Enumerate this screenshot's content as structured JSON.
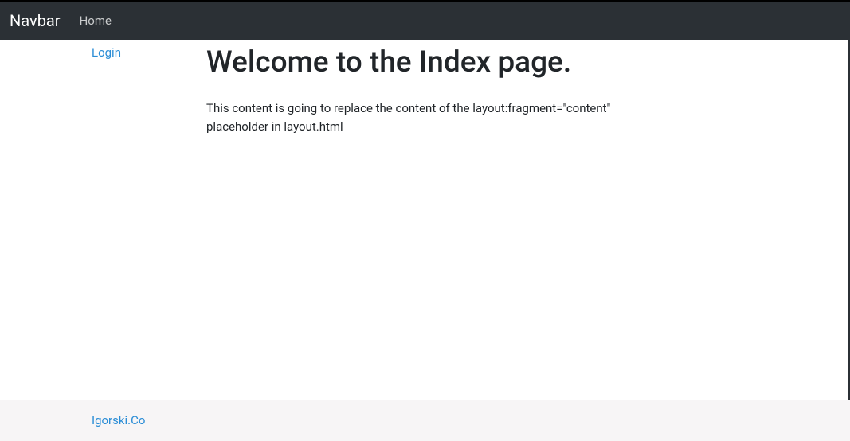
{
  "navbar": {
    "brand": "Navbar",
    "items": [
      {
        "label": "Home"
      }
    ]
  },
  "sidebar": {
    "login_label": "Login"
  },
  "main": {
    "heading": "Welcome to the Index page.",
    "body": "This content is going to replace the content of the layout:fragment=\"content\" placeholder in layout.html"
  },
  "footer": {
    "link_label": "Igorski.Co"
  }
}
